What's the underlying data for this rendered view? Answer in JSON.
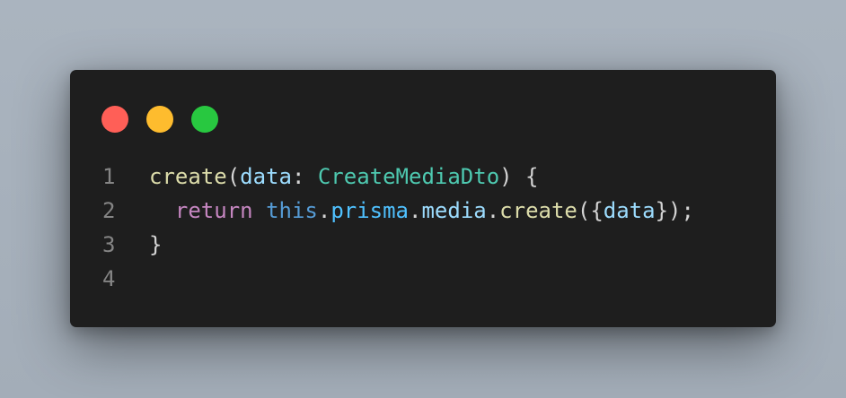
{
  "window": {
    "controls": {
      "close_color": "#ff5f57",
      "minimize_color": "#febc2e",
      "maximize_color": "#28c840"
    }
  },
  "code": {
    "lines": [
      {
        "number": "1",
        "tokens": [
          {
            "text": "create",
            "kind": "fn"
          },
          {
            "text": "(",
            "kind": "punc"
          },
          {
            "text": "data",
            "kind": "param"
          },
          {
            "text": ": ",
            "kind": "punc"
          },
          {
            "text": "CreateMediaDto",
            "kind": "type"
          },
          {
            "text": ") {",
            "kind": "punc"
          }
        ]
      },
      {
        "number": "2",
        "tokens": [
          {
            "text": "  ",
            "kind": "punc"
          },
          {
            "text": "return",
            "kind": "kw"
          },
          {
            "text": " ",
            "kind": "punc"
          },
          {
            "text": "this",
            "kind": "this"
          },
          {
            "text": ".",
            "kind": "punc"
          },
          {
            "text": "prisma",
            "kind": "prop"
          },
          {
            "text": ".",
            "kind": "punc"
          },
          {
            "text": "media",
            "kind": "prop2"
          },
          {
            "text": ".",
            "kind": "punc"
          },
          {
            "text": "create",
            "kind": "fn"
          },
          {
            "text": "({",
            "kind": "punc"
          },
          {
            "text": "data",
            "kind": "prop2"
          },
          {
            "text": "});",
            "kind": "punc"
          }
        ]
      },
      {
        "number": "3",
        "tokens": [
          {
            "text": "}",
            "kind": "punc"
          }
        ]
      },
      {
        "number": "4",
        "tokens": []
      }
    ]
  },
  "colors": {
    "background": "#1e1e1e",
    "line_number": "#858585"
  }
}
